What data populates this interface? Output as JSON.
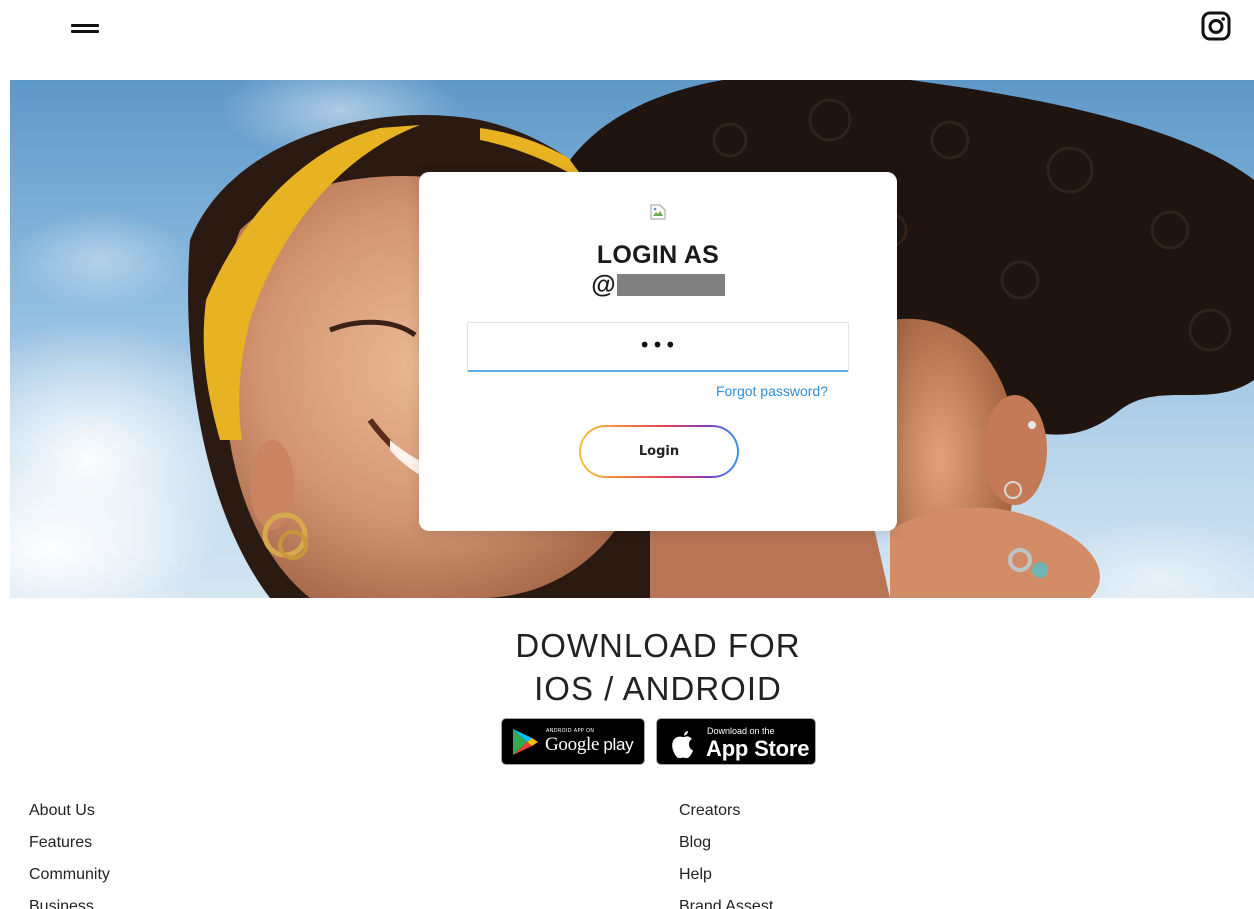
{
  "header": {
    "menu_icon": "hamburger-menu-icon",
    "brand_icon": "instagram-icon"
  },
  "hero": {
    "background": "photo of two smiling women against a blue sky"
  },
  "login_card": {
    "image_icon": "broken-image-icon",
    "title": "LOGIN AS",
    "username_prefix": "@",
    "password_value": "•••",
    "forgot_password": "Forgot password?",
    "login_button": "Login"
  },
  "download": {
    "title_line1": "DOWNLOAD FOR",
    "title_line2": "IOS / ANDROID",
    "google_play": {
      "small": "ANDROID APP ON",
      "brand": "Google",
      "store": "play",
      "icon": "google-play-icon"
    },
    "app_store": {
      "small": "Download on the",
      "store": "App Store",
      "icon": "apple-icon"
    }
  },
  "footer": {
    "left_links": [
      "About Us",
      "Features",
      "Community",
      "Business"
    ],
    "right_links": [
      "Creators",
      "Blog",
      "Help",
      "Brand Assest"
    ]
  },
  "colors": {
    "link_blue": "#2d8fd6",
    "input_underline": "#5fb0e6",
    "button_gradient": [
      "#f5c33b",
      "#f08a3e",
      "#e4405f",
      "#8a3ab9",
      "#3897f0"
    ]
  }
}
